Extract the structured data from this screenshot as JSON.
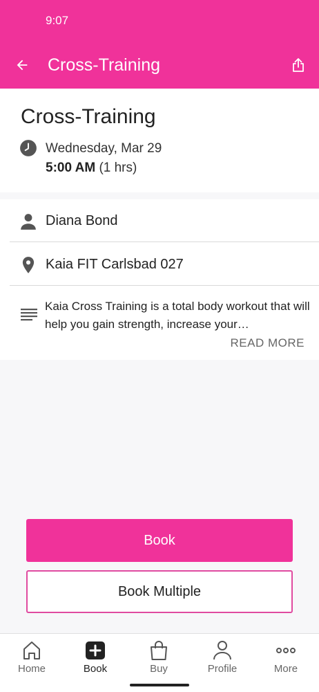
{
  "status_bar": {
    "time": "9:07"
  },
  "app_bar": {
    "title": "Cross-Training"
  },
  "class": {
    "title": "Cross-Training",
    "date": "Wednesday, Mar 29",
    "start_time": "5:00 AM",
    "duration": "(1 hrs)"
  },
  "details": {
    "instructor": "Diana Bond",
    "location": "Kaia FIT Carlsbad 027",
    "description": "Kaia Cross Training is a total body workout that will help you gain strength, increase your…",
    "read_more": "READ MORE"
  },
  "actions": {
    "book": "Book",
    "book_multiple": "Book Multiple"
  },
  "tabs": [
    {
      "label": "Home",
      "icon": "home-icon"
    },
    {
      "label": "Book",
      "icon": "plus-square-icon"
    },
    {
      "label": "Buy",
      "icon": "shopping-bag-icon"
    },
    {
      "label": "Profile",
      "icon": "profile-icon"
    },
    {
      "label": "More",
      "icon": "more-dots-icon"
    }
  ],
  "colors": {
    "brand": "#f0329a",
    "text": "#222222",
    "muted": "#666666"
  }
}
